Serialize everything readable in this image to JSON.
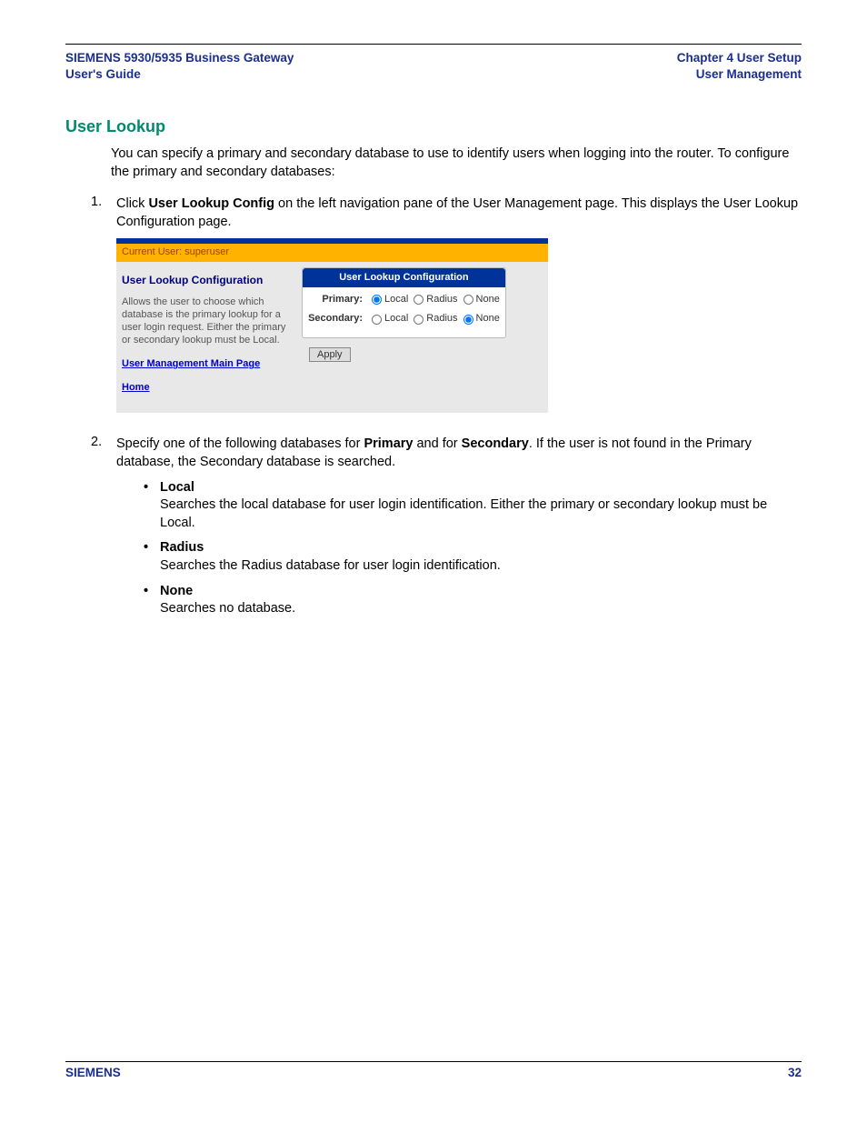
{
  "header": {
    "left_line1": "SIEMENS 5930/5935 Business Gateway",
    "left_line2": "User's Guide",
    "right_line1": "Chapter 4  User Setup",
    "right_line2": "User Management"
  },
  "section": {
    "heading": "User Lookup",
    "intro": "You can specify a primary and secondary database to use to identify users when logging into the router. To configure the primary and secondary databases:"
  },
  "steps": [
    {
      "num": "1.",
      "before": "Click ",
      "bold1": "User Lookup Config",
      "after": " on the left navigation pane of the User Management page. This displays the User Lookup Configuration page."
    },
    {
      "num": "2.",
      "before": "Specify one of the following databases for ",
      "bold1": "Primary",
      "middle": " and for ",
      "bold2": "Secondary",
      "after": ". If the user is not found in the Primary database, the Secondary database is searched."
    }
  ],
  "bullets": [
    {
      "title": "Local",
      "desc": "Searches the local database for user login identification. Either the primary or secondary lookup must be Local."
    },
    {
      "title": "Radius",
      "desc": "Searches the Radius database for user login identification."
    },
    {
      "title": "None",
      "desc": "Searches no database."
    }
  ],
  "shot": {
    "current_user": "Current User: superuser",
    "left_heading": "User Lookup Configuration",
    "left_desc": "Allows the user to choose which database is the primary lookup for a user login request. Either the primary or secondary lookup must be Local.",
    "link1": "User Management Main Page",
    "link2": "Home",
    "panel_title": "User Lookup Configuration",
    "rows": [
      {
        "label": "Primary:",
        "options": [
          "Local",
          "Radius",
          "None"
        ],
        "selected": 0
      },
      {
        "label": "Secondary:",
        "options": [
          "Local",
          "Radius",
          "None"
        ],
        "selected": 2
      }
    ],
    "apply": "Apply"
  },
  "footer": {
    "brand": "SIEMENS",
    "page": "32"
  }
}
